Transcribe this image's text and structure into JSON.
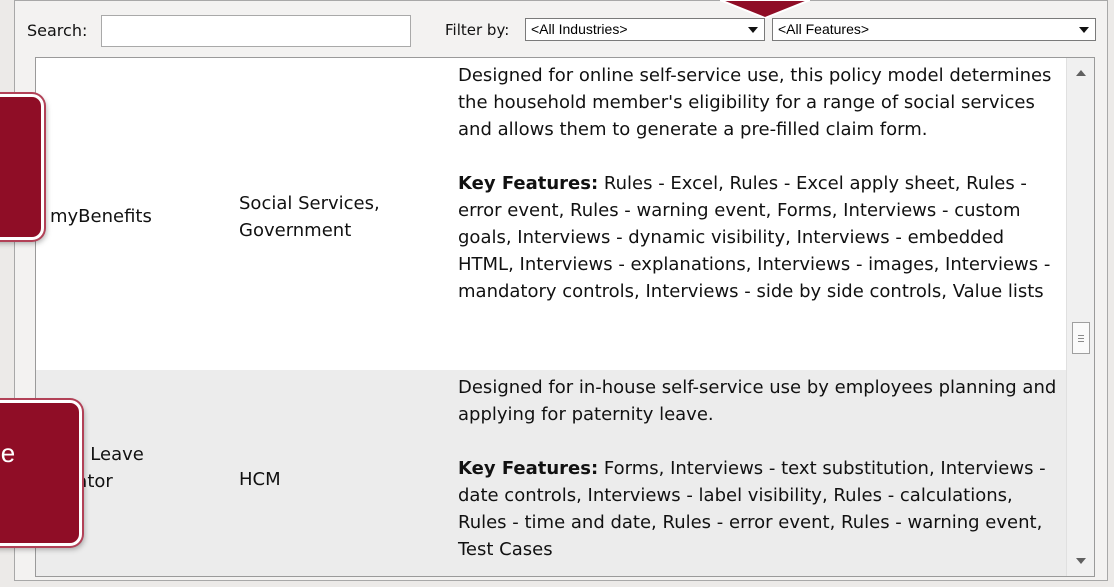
{
  "toolbar": {
    "search_label": "Search:",
    "search_value": "",
    "filter_label": "Filter by:",
    "industry_select": "<All Industries>",
    "feature_select": "<All Features>"
  },
  "rows": [
    {
      "name": "myBenefits",
      "industry": "Social Services, Government",
      "description": "Designed for online self-service use, this policy model determines the household member's eligibility for a range of social services and allows them to generate a pre-filled claim form.",
      "key_features_label": "Key Features:",
      "key_features": "Rules - Excel, Rules - Excel apply sheet, Rules - error event, Rules - warning event, Forms, Interviews - custom goals, Interviews - dynamic visibility, Interviews - embedded HTML, Interviews - explanations, Interviews - images, Interviews - mandatory controls, Interviews - side by side controls, Value lists"
    },
    {
      "name": "ental Leave culator",
      "industry": "HCM",
      "description": "Designed for in-house self-service use by employees planning and applying for paternity leave.",
      "key_features_label": "Key Features:",
      "key_features": "Forms, Interviews - text substitution, Interviews - date controls, Interviews - label visibility, Rules - calculations, Rules - time and date, Rules - error event, Rules - warning event, Test Cases"
    }
  ],
  "callout_text": "le",
  "colors": {
    "callout": "#8f0d26",
    "row_alt": "#ececec"
  }
}
